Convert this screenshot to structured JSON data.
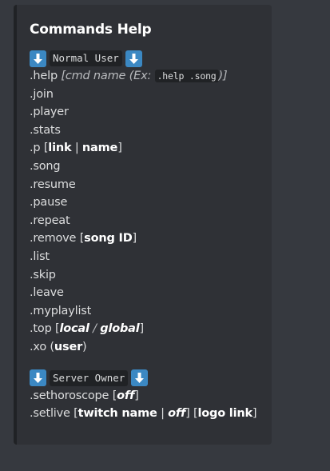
{
  "embed": {
    "title": "Commands Help",
    "accent_color": "#202225",
    "background": "#2f3136"
  },
  "sections": {
    "normal_user": {
      "header": "Normal User",
      "icon": "arrow-down-icon",
      "help": {
        "cmd": ".help",
        "hint_open": " [cmd name (Ex: ",
        "example": ".help .song",
        "hint_close": ")]"
      },
      "commands": {
        "join": ".join",
        "player": ".player",
        "stats": ".stats",
        "p": ".p",
        "p_arg_open": " [",
        "p_arg1": "link",
        "p_sep": " | ",
        "p_arg2": "name",
        "p_arg_close": "]",
        "song": ".song",
        "resume": ".resume",
        "pause": ".pause",
        "repeat": ".repeat",
        "remove": ".remove",
        "remove_open": " [",
        "remove_arg": "song ID",
        "remove_close": "]",
        "list": ".list",
        "skip": ".skip",
        "leave": ".leave",
        "myplaylist": ".myplaylist",
        "top": ".top",
        "top_open": " [",
        "top_arg1": "local",
        "top_sep": " / ",
        "top_arg2": "global",
        "top_close": "]",
        "xo": ".xo",
        "xo_open": " (",
        "xo_arg": "user",
        "xo_close": ")"
      }
    },
    "server_owner": {
      "header": "Server Owner",
      "icon": "arrow-down-icon",
      "commands": {
        "sethoroscope": ".sethoroscope",
        "sethoroscope_open": " [",
        "sethoroscope_arg": "off",
        "sethoroscope_close": "]",
        "setlive": ".setlive",
        "setlive_open": " [",
        "setlive_arg1": "twitch name",
        "setlive_sep": " | ",
        "setlive_arg2": "off",
        "setlive_mid": "]  [",
        "setlive_arg3": "logo link",
        "setlive_close": "]"
      }
    }
  },
  "colors": {
    "page_bg": "#36393f",
    "emoji_blue": "#3b88c3",
    "code_bg": "#202225",
    "text": "#dcddde",
    "bold_text": "#ffffff"
  }
}
